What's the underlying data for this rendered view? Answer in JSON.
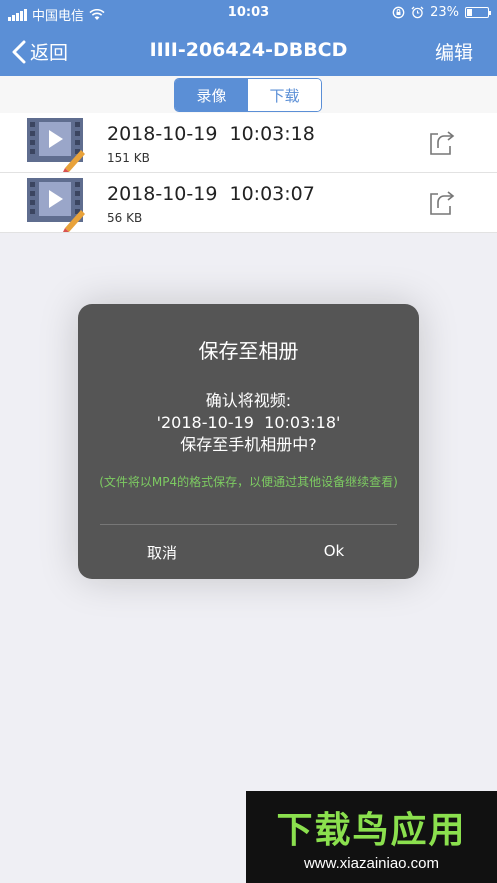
{
  "status_bar": {
    "carrier": "中国电信",
    "time": "10:03",
    "battery": "23%",
    "battery_level": 0.23
  },
  "nav": {
    "back_label": "返回",
    "title": "IIII-206424-DBBCD",
    "edit_label": "编辑"
  },
  "segment": {
    "tabs": [
      "录像",
      "下载"
    ],
    "active": "录像"
  },
  "recordings": [
    {
      "date": "2018-10-19  10:03:18",
      "size": "151 KB"
    },
    {
      "date": "2018-10-19  10:03:07",
      "size": "56 KB"
    }
  ],
  "dialog": {
    "title": "保存至相册",
    "message": "确认将视频:\n'2018-10-19  10:03:18'\n保存至手机相册中?",
    "note": "(文件将以MP4的格式保存，以便通过其他设备继续查看)",
    "cancel_label": "取消",
    "ok_label": "Ok"
  },
  "watermark": {
    "text": "下载鸟应用",
    "url": "www.xiazainiao.com"
  },
  "colors": {
    "nav_blue": "#5b8fd6",
    "dialog_bg": "#555555",
    "note_green": "#7dcb62"
  }
}
